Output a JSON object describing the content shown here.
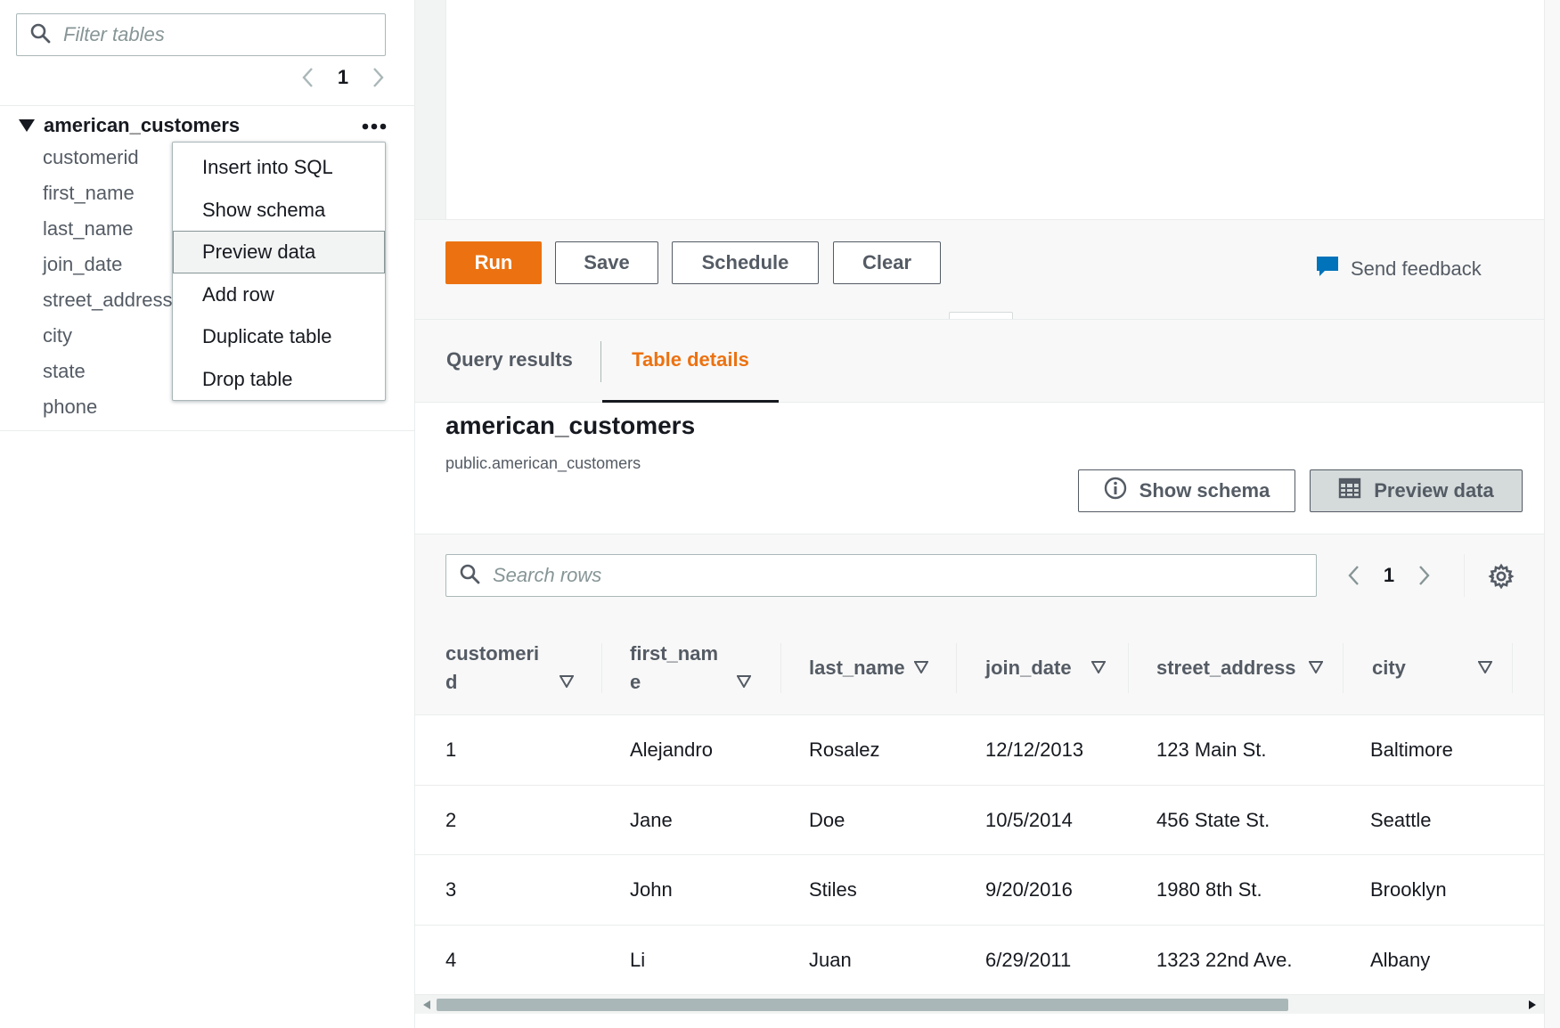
{
  "sidebar": {
    "filter_placeholder": "Filter tables",
    "page": "1",
    "table_name": "american_customers",
    "columns": [
      "customerid",
      "first_name",
      "last_name",
      "join_date",
      "street_address",
      "city",
      "state",
      "phone"
    ]
  },
  "context_menu": {
    "items": [
      "Insert into SQL",
      "Show schema",
      "Preview data",
      "Add row",
      "Duplicate table",
      "Drop table"
    ],
    "highlighted": "Preview data"
  },
  "toolbar": {
    "run_label": "Run",
    "save_label": "Save",
    "schedule_label": "Schedule",
    "clear_label": "Clear",
    "feedback_label": "Send feedback"
  },
  "tabs": {
    "query_results": "Query results",
    "table_details": "Table details",
    "active": "Table details"
  },
  "details": {
    "title": "american_customers",
    "subtitle": "public.american_customers",
    "show_schema_label": "Show schema",
    "preview_data_label": "Preview data"
  },
  "rows_search": {
    "placeholder": "Search rows",
    "page": "1"
  },
  "table": {
    "headers": [
      "customerid",
      "first_name",
      "last_name",
      "join_date",
      "street_address",
      "city"
    ],
    "rows": [
      [
        "1",
        "Alejandro",
        "Rosalez",
        "12/12/2013",
        "123 Main St.",
        "Baltimore"
      ],
      [
        "2",
        "Jane",
        "Doe",
        "10/5/2014",
        "456 State St.",
        "Seattle"
      ],
      [
        "3",
        "John",
        "Stiles",
        "9/20/2016",
        "1980 8th St.",
        "Brooklyn"
      ],
      [
        "4",
        "Li",
        "Juan",
        "6/29/2011",
        "1323 22nd Ave.",
        "Albany"
      ]
    ]
  },
  "colors": {
    "accent_orange": "#ec7211",
    "feedback_blue": "#0073bb",
    "text_dark": "#16191f",
    "text_muted": "#545b64"
  },
  "icons": {
    "search": "search-icon",
    "caret": "caret-down-icon",
    "more": "ellipsis-icon",
    "feedback": "speech-bubble-icon",
    "info": "info-icon",
    "table": "table-icon",
    "settings": "gear-icon",
    "sort": "sort-down-icon",
    "prev": "chevron-left-icon",
    "next": "chevron-right-icon"
  }
}
